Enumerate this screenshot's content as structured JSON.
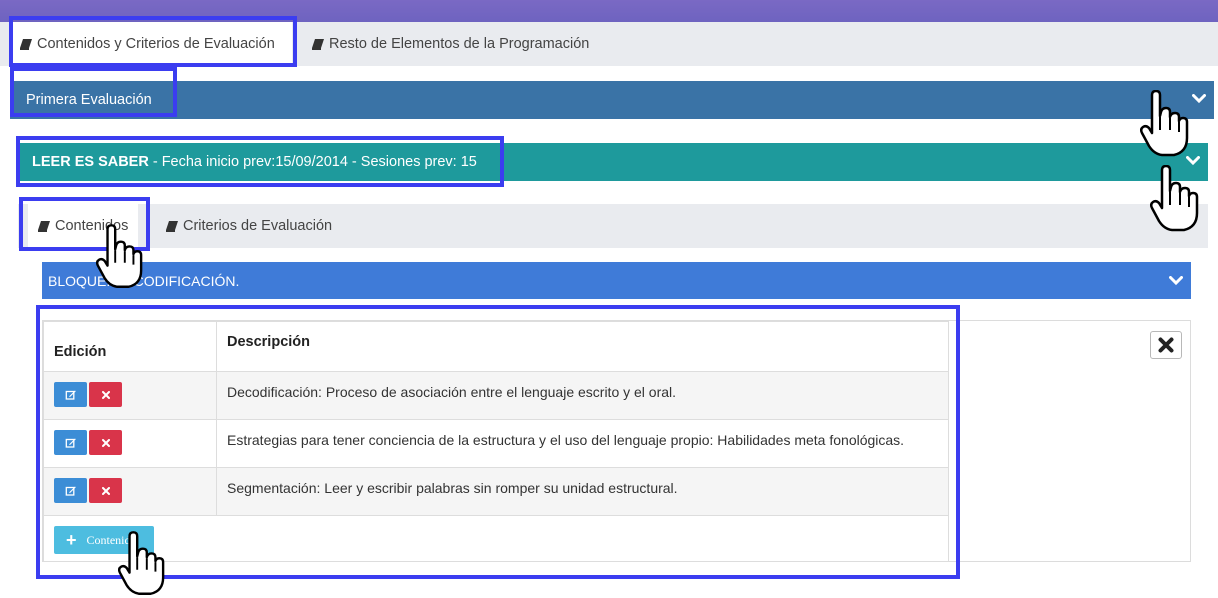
{
  "tabs": [
    {
      "label": "Contenidos y Criterios de Evaluación",
      "icon": "book-icon",
      "active": true
    },
    {
      "label": "Resto de Elementos de la Programación",
      "icon": "book-icon",
      "active": false
    }
  ],
  "evaluation": {
    "label": "Primera Evaluación"
  },
  "unit": {
    "title": "LEER ES SABER",
    "details": "- Fecha inicio prev:15/09/2014 - Sesiones prev: 15"
  },
  "subtabs": [
    {
      "label": "Contenidos",
      "icon": "book-icon",
      "active": true
    },
    {
      "label": "Criterios de Evaluación",
      "icon": "book-icon",
      "active": false
    }
  ],
  "block": {
    "label": "BLOQUE: DECODIFICACIÓN."
  },
  "table": {
    "columns": [
      "Edición",
      "Descripción"
    ],
    "rows": [
      {
        "description": "Decodificación: Proceso de asociación entre el lenguaje escrito y el oral."
      },
      {
        "description": "Estrategias para tener conciencia de la estructura y el uso del lenguaje propio: Habilidades meta fonológicas."
      },
      {
        "description": "Segmentación: Leer y escribir palabras sin romper su unidad estructural."
      }
    ],
    "add_label": "Contenido"
  },
  "colors": {
    "top_strip": "#7a69c4",
    "evaluation_bar": "#3a73a6",
    "unit_bar": "#1e9a9c",
    "block_bar": "#3f7bd8",
    "edit_button": "#3c8dd6",
    "delete_button": "#d9344a",
    "add_button": "#4dbde0",
    "highlight": "#3b3df0"
  }
}
